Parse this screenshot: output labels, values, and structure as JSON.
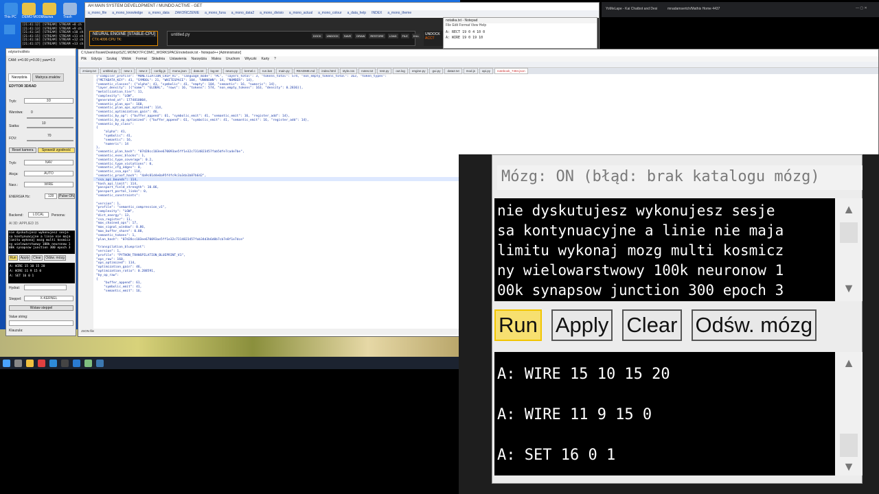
{
  "desktop": {
    "icons": [
      "This PC",
      "DEMO MODE",
      "Nazwa",
      "Trash"
    ],
    "taskbar": [
      "win",
      "search",
      "files",
      "chrome",
      "edge",
      "terminal",
      "code",
      "notepad",
      "python"
    ]
  },
  "browser": {
    "title": "AH MAIN SYSTEM DEVELOPMENT / MUNDO ACTIVE - GET",
    "bookmarks": [
      "a_mono_file",
      "a_mono_knowledge",
      "a_mono_data",
      "ZAKOŃCZENIE",
      "a_mono_funa",
      "a_mono_data2",
      "a_mono_divisio",
      "a_mono_actual",
      "a_mono_colour",
      "a_data_help",
      "INDEX",
      "a_mono_theme"
    ]
  },
  "neural": {
    "title": "NEURAL ENGINE [STABLE-CPU]",
    "ctx": "CTX:4096",
    "cpu": "CPU",
    "tk": "TK:"
  },
  "untitled": {
    "title": "untitled.py",
    "buttons": [
      "DOCK",
      "UNDOCK",
      "SAVE",
      "DRAW",
      "RESTORE",
      "LOAD",
      "FILE",
      "KILL",
      "PANEL"
    ]
  },
  "undock": {
    "label": "UNDOCK",
    "sub": "ACCT"
  },
  "notepad_small": {
    "title": "notatka.txt - Notepad",
    "menu": "File  Edit  Format  View  Help",
    "lines": [
      "A: RECT 19 0 4 10 0",
      "A: WIRE 19 0 19 10"
    ]
  },
  "right_tabs": [
    "YoMeLape - Kai Chatbot and Desi",
    "mnadamsertch/Mathis Home 4437"
  ],
  "left_app": {
    "title": "edytor/nolifelo",
    "coords": "CAM: x=0.00  y=0.00 | yaw=0.0",
    "tabs": [
      "Narzędzia",
      "Matryca znaków"
    ],
    "heading": "EDYTOR 3D/6AD",
    "fields": {
      "tryb_label": "Tryb:",
      "tryb_value": "3D",
      "warstwa_label": "Warstwa:",
      "warstwa_value": "0",
      "siatka_label": "Siatka:",
      "siatka_value": "10",
      "fov_label": "FOV:",
      "fov_value": "70",
      "reset": "Reset kamera",
      "check": "Sprawdź zgodność",
      "tryb2_label": "Tryb:",
      "tryb2_value": "NAV",
      "akcja_label": "Akcja:",
      "akcja_value": "AUTO",
      "narz_label": "Narz.:",
      "narz_value": "WIRE",
      "energia_label": "ENERGIA Hz:",
      "energia_value": "128",
      "pulse": "Pulse ON",
      "backend_label": "Backend:",
      "backend_value": "LOCAL",
      "persona_label": "Persona:",
      "ai_label": "AI 3D: APPLIED 15",
      "hydrat_label": "Hydrat:",
      "steppel_label": "Steppel:",
      "steppel_value": "X-KERNEL",
      "insert": "Wstaw steppel",
      "value_label": "Value string:",
      "closing_label": "Klauzula:"
    },
    "console": "nie dyskutujesz wykonujesz sesje\nsa kontynuacyjne a linie nie maja\nlimitu wykonaj mozg multi kosmicz\nny wielowarstwowy 100k neuronow 1\n00k synapsow junction 300 epoch 3",
    "buttons": [
      "Run",
      "Apply",
      "Clear",
      "Odśw. mózg"
    ],
    "output": [
      "A: WIRE 15 10 15 20",
      "A: WIRE 11 9 15 0",
      "A: SET 16 0 1"
    ]
  },
  "editor": {
    "path": "C:\\Users\\Tosiek\\Desktop\\SZC.MONO\\TF\\CDMC_WORKSPACE\\notebook.txt - Notepad++ [Administrator]",
    "menu": [
      "Plik",
      "Edycja",
      "Szukaj",
      "Widok",
      "Format",
      "Składnia",
      "Ustawienia",
      "Narzędzia",
      "Makra",
      "Uruchom",
      "Wtyczki",
      "Karty",
      "?"
    ],
    "tabs": [
      "zmiany.txt",
      "untitled.py",
      "new 1",
      "new 2",
      "config.js",
      "mono.json",
      "data.txt",
      "log.txt",
      "neuro.py",
      "kernel.c",
      "run.bat",
      "main.py",
      "README.md",
      "index.html",
      "style.css",
      "notes.txt",
      "test.py",
      "out.log",
      "engine.py",
      "gui.py",
      "data2.txt",
      "mod.js",
      "api.py",
      "notebook_7484.json"
    ],
    "active_tab_index": 23,
    "code": "{\"compiler_profile\": \"MONETIZATION_CHIP_V1\", \"language_mode\": \"PL\", \"layers_total\": 3, \"tokens_total\": 574, \"non_empty_tokens_total\": 163, \"token_types\":\n{\"METADATA_KEY\": 41, \"SYMBOL\": 21, \"WHITESPACE\": 104, \"UNKNOWN\": 14, \"NUMBER\": 14},\n\"semantic_classes\": {\"alpha\": 41, \"symbolic\": 41, \"empty\": 104, \"semantic\": 16, \"numeric\": 14},\n\"layer_density\": [{\"name\": \"GLOBAL\", \"rows\": 16, \"tokens\": 574, \"non_empty_tokens\": 163, \"density\": 0.2836}],\n\"metallization_tier\": 11,\n\"complexity\": \"LOW\",\n\"generated_at\": 1774810004,\n\"semantic_plan_ops\": 160,\n\"semantic_plan_ops_optimized\": 114,\n\"semantic_optimization_gain\": 46,\n\"semantic_by_op\": {\"buffer_append\": 61, \"symbolic_emit\": 41, \"semantic_emit\": 16, \"register_add\": 14},\n\"semantic_by_op_optimized\": {\"buffer_append\": 61, \"symbolic_emit\": 41, \"semantic_emit\": 16, \"register_add\": 14},\n\"semantic_by_class\":\n{\n    \"alpha\": 41,\n    \"symbolic\": 41,\n    \"semantic\": 16,\n    \"numeric\": 14\n},\n\"semantic_plan_hash\": \"07d28cc103ee670093ae5ff1e32c7314823457fab5dfe7ca4e7be\",\n\"semantic_exec_blocks\": 1,\n\"semantic_type_coverage\": 0.2,\n\"semantic_type_violations\": 0,\n\"semantic_cfg_edges\": 0,\n\"semantic_ssa_ops\": 114,\n\"semantic_proof_hash\": \"4a9c81d4e0a95f4fc9c3a3da1b87b642\",\n\"ssa_api_bounds\": 114,\n\"hash_api_limit\": 114,\n\"passport_field_strength\": 10.06,\n\"passport_portal_links\": 0,\n\"semantic_constraints\":\n\n\"version\": 1,\n\"profile\": \"semantic_compression_v1\",\n\"complexity\": \"LOW\",\n\"dict_energy\": 13,\n\"ssa_register\": 11,\n\"max_chained_ops\": 17,\n\"max_signal_window\": 0.86,\n\"max_buffer_share\": 0.88,\n\"semantic_tokens\": 1,\n\"plan_hash\": \"07d28cc103ee670093ae5ff1e32c7314823457fab34d3b6d0b7cb7e8f1e7dce\"\n\n\"transpilation_blueprint\":\n\"version\": 1,\n\"profile\": \"PYTHON_TRANSPILATION_BLUEPRINT_V1\",\n\"ops_raw\": 160,\n\"ops_optimized\": 114,\n\"optimization_gain\": 46,\n\"optimization_ratio\": 0.288591,\n\"by_op_raw\":\n{\n    \"buffer_append\": 61,\n    \"symbolic_emit\": 41,\n    \"semantic_emit\": 16,",
    "status": "JSON file"
  },
  "zoom": {
    "status": "Mózg: ON (błąd: brak katalogu mózg)"
  },
  "colors": {
    "accent": "#f2c500",
    "console_bg": "#000000",
    "code": "#1a3aa8"
  }
}
